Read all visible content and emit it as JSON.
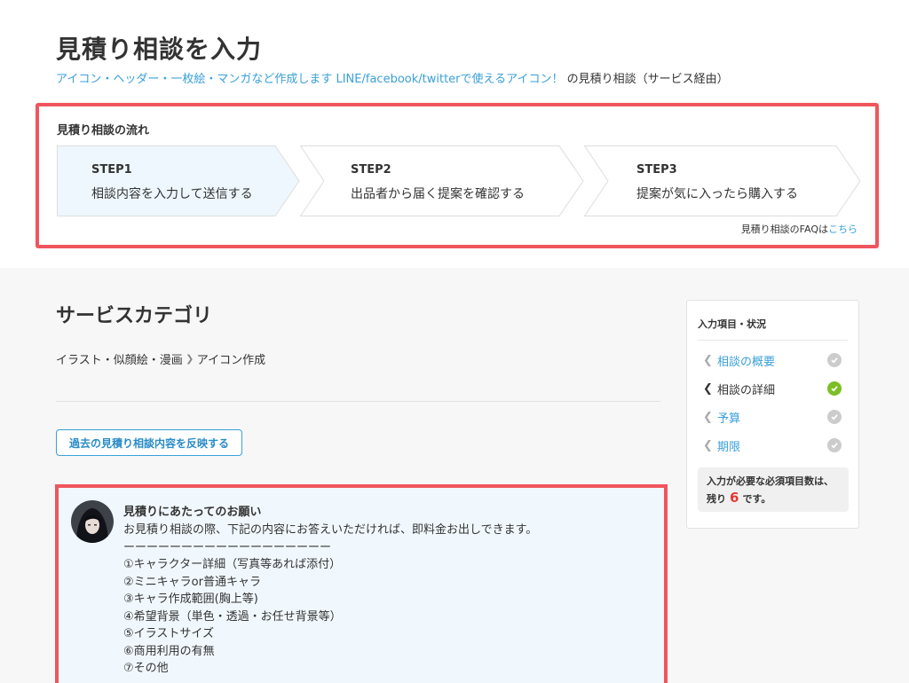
{
  "header": {
    "title": "見積り相談を入力",
    "service_link": "アイコン・ヘッダー・一枚絵・マンガなど作成します LINE/facebook/twitterで使えるアイコン！",
    "service_suffix": "の見積り相談（サービス経由）"
  },
  "flow": {
    "title": "見積り相談の流れ",
    "steps": [
      {
        "num": "STEP1",
        "text": "相談内容を入力して送信する"
      },
      {
        "num": "STEP2",
        "text": "出品者から届く提案を確認する"
      },
      {
        "num": "STEP3",
        "text": "提案が気に入ったら購入する"
      }
    ],
    "faq_prefix": "見積り相談のFAQは",
    "faq_link": "こちら"
  },
  "category": {
    "title": "サービスカテゴリ",
    "breadcrumb": [
      "イラスト・似顔絵・漫画",
      "アイコン作成"
    ]
  },
  "reflect_button": "過去の見積り相談内容を反映する",
  "request": {
    "heading": "見積りにあたってのお願い",
    "lines": [
      "お見積り相談の際、下記の内容にお答えいただければ、即料金お出しできます。",
      "ーーーーーーーーーーーーーーーーーー",
      "①キャラクター詳細（写真等あれば添付）",
      "②ミニキャラor普通キャラ",
      "③キャラ作成範囲(胸上等)",
      "④希望背景（単色・透過・お任せ背景等）",
      "⑤イラストサイズ",
      "⑥商用利用の有無",
      "⑦その他"
    ]
  },
  "sidebar": {
    "title": "入力項目・状況",
    "items": [
      {
        "label": "相談の概要",
        "state": "pending"
      },
      {
        "label": "相談の詳細",
        "state": "done"
      },
      {
        "label": "予算",
        "state": "pending"
      },
      {
        "label": "期限",
        "state": "pending"
      }
    ],
    "note_line1": "入力が必要な必須項目数は、",
    "note_prefix": "残り",
    "remaining": "6",
    "note_suffix": "です。"
  },
  "colors": {
    "accent_blue": "#3aa0d9",
    "highlight_red": "#f0555d",
    "check_green": "#7cbf24",
    "check_gray": "#cccccc",
    "count_red": "#e53935",
    "step_active_bg": "#eef7fd"
  }
}
